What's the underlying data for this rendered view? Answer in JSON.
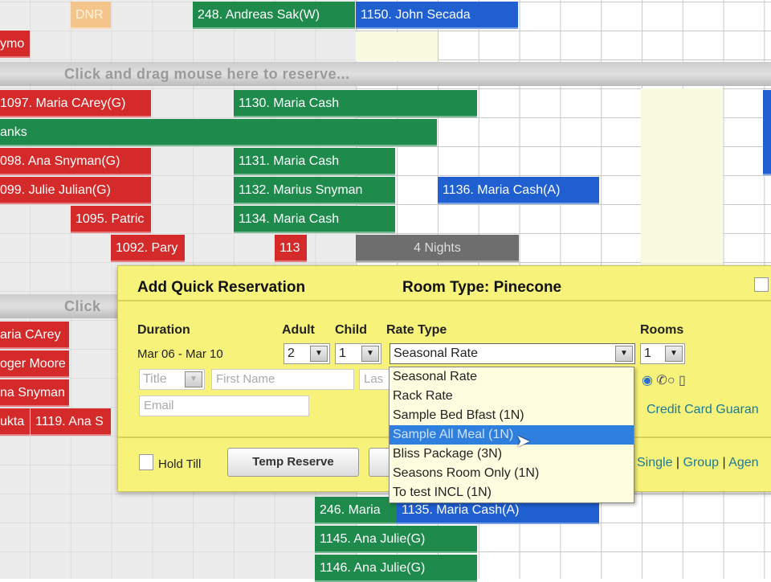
{
  "grid": {
    "row0": [
      "DNR",
      "248. Andreas Sak(W)",
      "1150. John Secada"
    ],
    "row1": [
      "ymo"
    ],
    "separator_hint": "Click and drag mouse here to reserve...",
    "separator2_hint": "Click",
    "row2": [
      "1097. Maria CArey(G)",
      "1130. Maria Cash"
    ],
    "row3": [
      "anks"
    ],
    "row4": [
      "098. Ana Snyman(G)",
      "1131. Maria Cash"
    ],
    "row5": [
      "099. Julie Julian(G)",
      "1132. Marius Snyman",
      "1136. Maria Cash(A)"
    ],
    "row6": [
      "1095. Patric",
      "1134. Maria Cash"
    ],
    "row7": [
      "1092. Pary",
      "113",
      "4 Nights"
    ],
    "left_rows": [
      "aria CArey",
      "oger Moore",
      "na Snyman",
      "ukta",
      "1119. Ana S"
    ],
    "bottom": [
      "246. Maria",
      "1135. Maria Cash(A)",
      "1145. Ana Julie(G)",
      "1146. Ana Julie(G)"
    ]
  },
  "dialog": {
    "title": "Add Quick Reservation",
    "room_type": "Room Type: Pinecone",
    "duration_label": "Duration",
    "duration_value": "Mar 06 - Mar 10",
    "adult_label": "Adult",
    "adult_value": "2",
    "child_label": "Child",
    "child_value": "1",
    "rate_label": "Rate Type",
    "rate_value": "Seasonal Rate",
    "rooms_label": "Rooms",
    "rooms_value": "1",
    "title_placeholder": "Title",
    "first_name_placeholder": "First Name",
    "last_name_placeholder": "Las",
    "email_placeholder": "Email",
    "credit_card": "Credit Card Guaran",
    "hold_till": "Hold Till",
    "temp_reserve": "Temp Reserve",
    "links": [
      "Single",
      "Group",
      "Agen"
    ],
    "rate_options": [
      "Seasonal Rate",
      "Rack Rate",
      "Sample Bed Bfast (1N)",
      "Sample All Meal (1N)",
      "Bliss Package (3N)",
      "Seasons Room Only (1N)",
      "To test INCL (1N)"
    ]
  }
}
